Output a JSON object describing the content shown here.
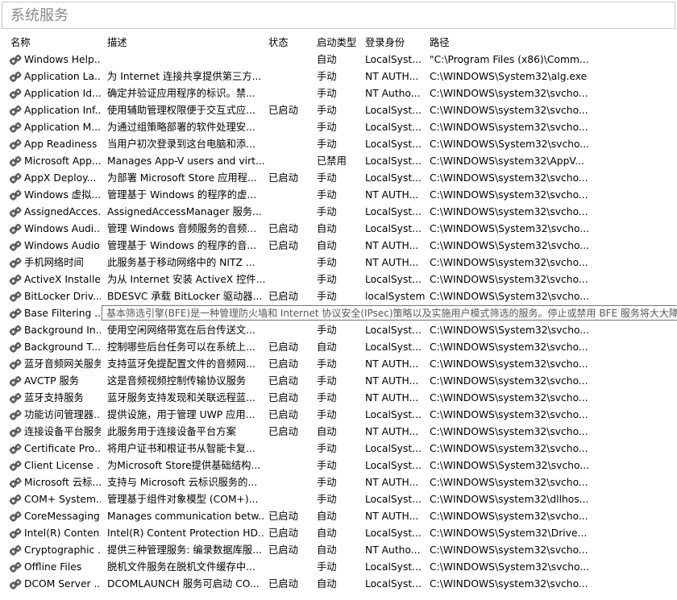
{
  "search": {
    "placeholder": "系统服务"
  },
  "columns": {
    "name": "名称",
    "description": "描述",
    "status": "状态",
    "startup": "启动类型",
    "logon": "登录身份",
    "path": "路径"
  },
  "tooltip": {
    "row_index": 15,
    "text": "基本筛选引擎(BFE)是一种管理防火墙和 Internet 协议安全(IPsec)策略以及实施用户模式筛选的服务。停止或禁用 BFE 服务将大大降低"
  },
  "icons": {
    "service": "gear-pair-icon"
  },
  "rows": [
    {
      "name": "Windows Help...",
      "description": "",
      "status": "",
      "startup": "自动",
      "logon": "LocalSyst...",
      "path": "\"C:\\Program Files (x86)\\Comm..."
    },
    {
      "name": "Application La...",
      "description": "为 Internet 连接共享提供第三方...",
      "status": "",
      "startup": "手动",
      "logon": "NT AUTH...",
      "path": "C:\\WINDOWS\\System32\\alg.exe"
    },
    {
      "name": "Application Id...",
      "description": "确定并验证应用程序的标识。禁...",
      "status": "",
      "startup": "手动",
      "logon": "NT Autho...",
      "path": "C:\\WINDOWS\\system32\\svcho..."
    },
    {
      "name": "Application Inf...",
      "description": "使用辅助管理权限便于交互式应...",
      "status": "已启动",
      "startup": "手动",
      "logon": "LocalSyst...",
      "path": "C:\\WINDOWS\\system32\\svcho..."
    },
    {
      "name": "Application M...",
      "description": "为通过组策略部署的软件处理安...",
      "status": "",
      "startup": "手动",
      "logon": "LocalSyst...",
      "path": "C:\\WINDOWS\\system32\\svcho..."
    },
    {
      "name": "App Readiness",
      "description": "当用户初次登录到这台电脑和添...",
      "status": "",
      "startup": "手动",
      "logon": "LocalSyst...",
      "path": "C:\\WINDOWS\\System32\\svcho..."
    },
    {
      "name": "Microsoft App...",
      "description": "Manages App-V users and virt...",
      "status": "",
      "startup": "已禁用",
      "logon": "LocalSyst...",
      "path": "C:\\WINDOWS\\system32\\AppV..."
    },
    {
      "name": "AppX Deploy...",
      "description": "为部署 Microsoft Store 应用程...",
      "status": "已启动",
      "startup": "手动",
      "logon": "LocalSyst...",
      "path": "C:\\WINDOWS\\system32\\svcho..."
    },
    {
      "name": "Windows 虚拟...",
      "description": "管理基于 Windows 的程序的虚...",
      "status": "",
      "startup": "手动",
      "logon": "NT AUTH...",
      "path": "C:\\WINDOWS\\system32\\svcho..."
    },
    {
      "name": "AssignedAcces...",
      "description": "AssignedAccessManager 服务...",
      "status": "",
      "startup": "手动",
      "logon": "LocalSyst...",
      "path": "C:\\WINDOWS\\system32\\svcho..."
    },
    {
      "name": "Windows Audi...",
      "description": "管理 Windows 音频服务的音频...",
      "status": "已启动",
      "startup": "自动",
      "logon": "LocalSyst...",
      "path": "C:\\WINDOWS\\System32\\svcho..."
    },
    {
      "name": "Windows Audio",
      "description": "管理基于 Windows 的程序的音...",
      "status": "已启动",
      "startup": "自动",
      "logon": "NT AUTH...",
      "path": "C:\\WINDOWS\\System32\\svcho..."
    },
    {
      "name": "手机网络时间",
      "description": "此服务基于移动网络中的 NITZ ...",
      "status": "",
      "startup": "手动",
      "logon": "NT AUTH...",
      "path": "C:\\WINDOWS\\system32\\svcho..."
    },
    {
      "name": "ActiveX Installe...",
      "description": "为从 Internet 安装 ActiveX 控件...",
      "status": "",
      "startup": "手动",
      "logon": "LocalSyst...",
      "path": "C:\\WINDOWS\\system32\\svcho..."
    },
    {
      "name": "BitLocker Driv...",
      "description": "BDESVC 承载 BitLocker 驱动器...",
      "status": "已启动",
      "startup": "手动",
      "logon": "localSystem",
      "path": "C:\\WINDOWS\\System32\\svcho..."
    },
    {
      "name": "Base Filtering ...",
      "description": "",
      "status": "",
      "startup": "",
      "logon": "",
      "path": ""
    },
    {
      "name": "Background In...",
      "description": "使用空闲网络带宽在后台传送文...",
      "status": "",
      "startup": "手动",
      "logon": "LocalSyst...",
      "path": "C:\\WINDOWS\\System32\\svcho..."
    },
    {
      "name": "Background T...",
      "description": "控制哪些后台任务可以在系统上...",
      "status": "已启动",
      "startup": "自动",
      "logon": "LocalSyst...",
      "path": "C:\\WINDOWS\\system32\\svcho..."
    },
    {
      "name": "蓝牙音频网关服务",
      "description": "支持蓝牙免提配置文件的音频网...",
      "status": "已启动",
      "startup": "手动",
      "logon": "NT AUTH...",
      "path": "C:\\WINDOWS\\system32\\svcho..."
    },
    {
      "name": "AVCTP 服务",
      "description": "这是音频视频控制传输协议服务",
      "status": "已启动",
      "startup": "手动",
      "logon": "NT AUTH...",
      "path": "C:\\WINDOWS\\system32\\svcho..."
    },
    {
      "name": "蓝牙支持服务",
      "description": "蓝牙服务支持发现和关联远程蓝...",
      "status": "已启动",
      "startup": "手动",
      "logon": "NT AUTH...",
      "path": "C:\\WINDOWS\\system32\\svcho..."
    },
    {
      "name": "功能访问管理器...",
      "description": "提供设施，用于管理 UWP 应用...",
      "status": "已启动",
      "startup": "手动",
      "logon": "LocalSyst...",
      "path": "C:\\WINDOWS\\system32\\svcho..."
    },
    {
      "name": "连接设备平台服务",
      "description": "此服务用于连接设备平台方案",
      "status": "已启动",
      "startup": "自动",
      "logon": "NT AUTH...",
      "path": "C:\\WINDOWS\\system32\\svcho..."
    },
    {
      "name": "Certificate Pro...",
      "description": "将用户证书和根证书从智能卡复...",
      "status": "",
      "startup": "手动",
      "logon": "LocalSyst...",
      "path": "C:\\WINDOWS\\system32\\svcho..."
    },
    {
      "name": "Client License ...",
      "description": "为Microsoft Store提供基础结构...",
      "status": "",
      "startup": "手动",
      "logon": "LocalSyst...",
      "path": "C:\\WINDOWS\\System32\\svcho..."
    },
    {
      "name": "Microsoft 云标...",
      "description": "支持与 Microsoft 云标识服务的...",
      "status": "",
      "startup": "手动",
      "logon": "NT AUTH...",
      "path": "C:\\WINDOWS\\system32\\svcho..."
    },
    {
      "name": "COM+ System...",
      "description": "管理基于组件对象模型 (COM+)...",
      "status": "",
      "startup": "手动",
      "logon": "LocalSyst...",
      "path": "C:\\WINDOWS\\system32\\dllhos..."
    },
    {
      "name": "CoreMessaging",
      "description": "Manages communication betw...",
      "status": "已启动",
      "startup": "自动",
      "logon": "NT AUTH...",
      "path": "C:\\WINDOWS\\system32\\svcho..."
    },
    {
      "name": "Intel(R) Conten...",
      "description": "Intel(R) Content Protection HD...",
      "status": "已启动",
      "startup": "自动",
      "logon": "LocalSyst...",
      "path": "C:\\WINDOWS\\System32\\Drive..."
    },
    {
      "name": "Cryptographic ...",
      "description": "提供三种管理服务: 编录数据库服...",
      "status": "已启动",
      "startup": "自动",
      "logon": "NT Autho...",
      "path": "C:\\WINDOWS\\system32\\svcho..."
    },
    {
      "name": "Offline Files",
      "description": "脱机文件服务在脱机文件缓存中...",
      "status": "",
      "startup": "手动",
      "logon": "LocalSyst...",
      "path": "C:\\WINDOWS\\System32\\svcho..."
    },
    {
      "name": "DCOM Server ...",
      "description": "DCOMLAUNCH 服务可启动 CO...",
      "status": "已启动",
      "startup": "自动",
      "logon": "LocalSyst...",
      "path": "C:\\WINDOWS\\system32\\svcho..."
    }
  ]
}
